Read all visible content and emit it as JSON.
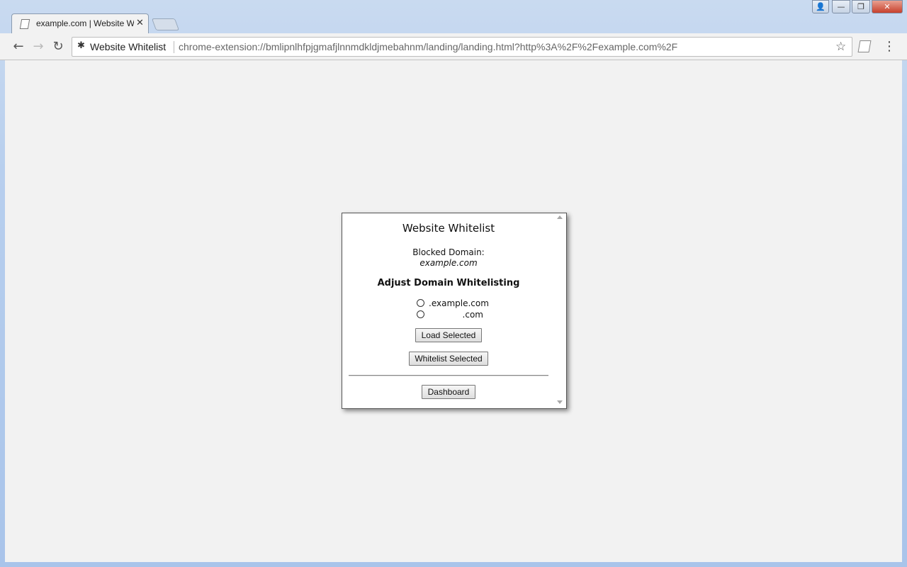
{
  "browser": {
    "tab": {
      "title": "example.com | Website Whitelist",
      "close_glyph": "✕"
    },
    "window_controls": {
      "user": "👤",
      "minimize": "—",
      "maximize": "❐",
      "close": "✕"
    },
    "toolbar": {
      "back_glyph": "←",
      "forward_glyph": "→",
      "reload_glyph": "↻",
      "extension_chip": "Website Whitelist",
      "url": "chrome-extension://bmlipnlhfpjgmafjlnnmdkldjmebahnm/landing/landing.html?http%3A%2F%2Fexample.com%2F",
      "star_glyph": "☆",
      "menu_glyph": "⋮"
    }
  },
  "popup": {
    "title": "Website Whitelist",
    "blocked_label": "Blocked Domain:",
    "blocked_domain": "example.com",
    "adjust_heading": "Adjust Domain Whitelisting",
    "options": [
      {
        "label": ".example.com"
      },
      {
        "label": ".com"
      }
    ],
    "load_button": "Load Selected",
    "whitelist_button": "Whitelist Selected",
    "dashboard_button": "Dashboard"
  }
}
